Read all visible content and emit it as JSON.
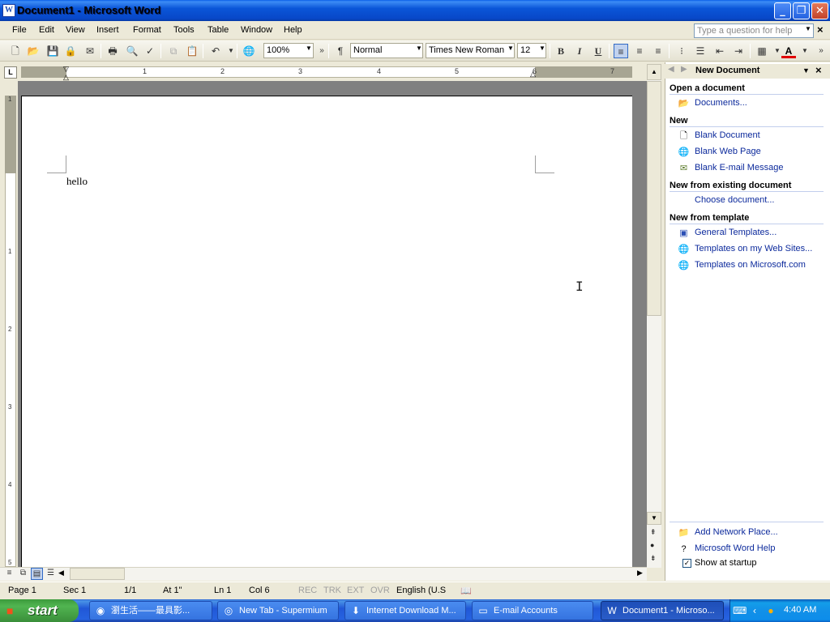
{
  "window": {
    "title": "Document1 - Microsoft Word",
    "icon_letter": "W"
  },
  "caption_buttons": {
    "minimize": "_",
    "maximize": "❐",
    "close": "✕"
  },
  "menu": {
    "items": [
      "File",
      "Edit",
      "View",
      "Insert",
      "Format",
      "Tools",
      "Table",
      "Window",
      "Help"
    ],
    "help_placeholder": "Type a question for help",
    "close_glyph": "×"
  },
  "toolbar": {
    "zoom": "100%",
    "style": "Normal",
    "font": "Times New Roman",
    "size": "12",
    "bold": "B",
    "italic": "I",
    "underline": "U",
    "font_color_glyph": "A",
    "more_glyph": "»"
  },
  "ruler": {
    "tab_selector": "L",
    "h_numbers": [
      "1",
      "2",
      "3",
      "4",
      "5",
      "6",
      "7"
    ],
    "v_numbers": [
      "1",
      "1",
      "2",
      "3",
      "4",
      "5"
    ]
  },
  "document": {
    "text": "hello"
  },
  "task_pane": {
    "title": "New Document",
    "sections": [
      {
        "heading": "Open a document",
        "links": [
          "Documents..."
        ]
      },
      {
        "heading": "New",
        "links": [
          "Blank Document",
          "Blank Web Page",
          "Blank E-mail Message"
        ]
      },
      {
        "heading": "New from existing document",
        "links": [
          "Choose document..."
        ]
      },
      {
        "heading": "New from template",
        "links": [
          "General Templates...",
          "Templates on my Web Sites...",
          "Templates on Microsoft.com"
        ]
      }
    ],
    "bottom_links": [
      "Add Network Place...",
      "Microsoft Word Help"
    ],
    "show_at_startup": {
      "label": "Show at startup",
      "checked": true
    }
  },
  "status_bar": {
    "page": "Page 1",
    "sec": "Sec 1",
    "pages": "1/1",
    "at": "At 1\"",
    "ln": "Ln 1",
    "col": "Col 6",
    "rec": "REC",
    "trk": "TRK",
    "ext": "EXT",
    "ovr": "OVR",
    "language": "English (U.S"
  },
  "taskbar": {
    "start_label": "start",
    "tasks": [
      {
        "label": "瀏生活——最具影..."
      },
      {
        "label": "New Tab - Supermium"
      },
      {
        "label": "Internet Download M..."
      },
      {
        "label": "E-mail Accounts"
      },
      {
        "label": "Document1 - Microso...",
        "active": true
      }
    ],
    "clock": "4:40 AM"
  }
}
